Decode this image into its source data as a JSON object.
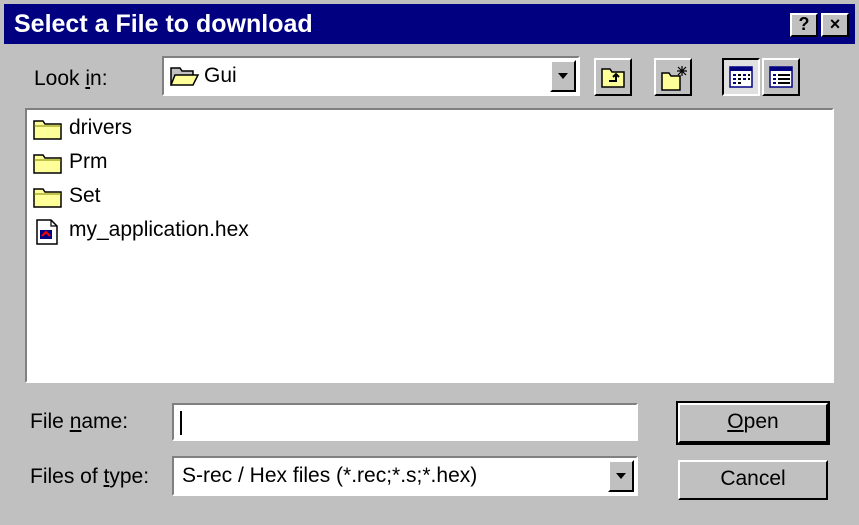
{
  "window": {
    "title": "Select a File to download",
    "help_glyph": "?",
    "close_glyph": "×"
  },
  "lookin": {
    "label_pre": "Look ",
    "label_accel": "i",
    "label_post": "n:",
    "value": "Gui",
    "icon": "open-folder-icon"
  },
  "toolbar": {
    "buttons": [
      {
        "name": "up-one-level-button",
        "icon": "folder-up-icon"
      },
      {
        "name": "create-new-folder-button",
        "icon": "new-folder-icon"
      },
      {
        "name": "list-view-button",
        "icon": "list-view-icon",
        "pressed": true
      },
      {
        "name": "details-view-button",
        "icon": "details-view-icon",
        "pressed": false
      }
    ]
  },
  "files": [
    {
      "name": "drivers",
      "type": "folder",
      "icon": "folder-icon"
    },
    {
      "name": "Prm",
      "type": "folder",
      "icon": "folder-icon"
    },
    {
      "name": "Set",
      "type": "folder",
      "icon": "folder-icon"
    },
    {
      "name": "my_application.hex",
      "type": "file",
      "icon": "hex-file-icon"
    }
  ],
  "filename": {
    "label_pre": "File ",
    "label_accel": "n",
    "label_post": "ame:",
    "value": "",
    "placeholder": ""
  },
  "filetype": {
    "label_pre": "Files of ",
    "label_accel": "t",
    "label_post": "ype:",
    "value": "S-rec / Hex files (*.rec;*.s;*.hex)"
  },
  "actions": {
    "open_accel": "O",
    "open_rest": "pen",
    "cancel": "Cancel"
  },
  "colors": {
    "titlebar": "#000080",
    "face": "#c0c0c0",
    "folder": "#ffff99"
  }
}
